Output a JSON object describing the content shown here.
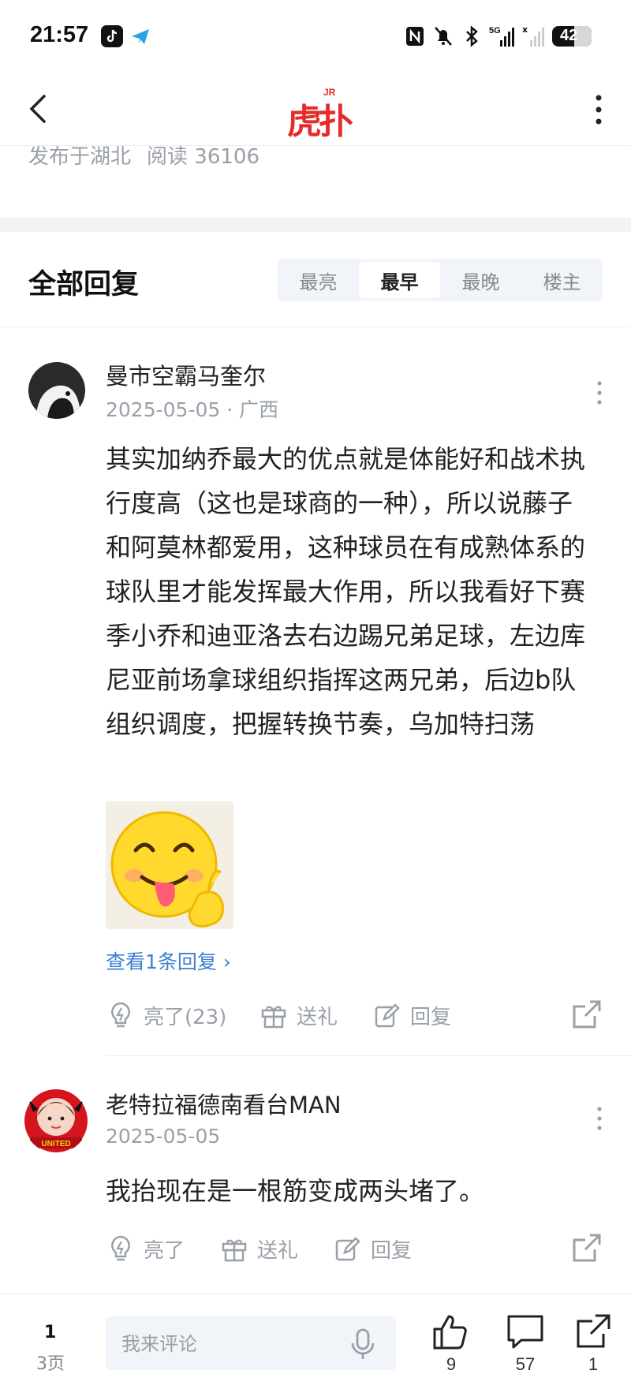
{
  "status_bar": {
    "time": "21:57",
    "battery": "42"
  },
  "nav": {
    "logo_text": "虎扑",
    "logo_badge": "JR"
  },
  "post_meta": {
    "location": "发布于湖北",
    "reads": "阅读 36106"
  },
  "replies": {
    "title": "全部回复",
    "sort_tabs": [
      "最亮",
      "最早",
      "最晚",
      "楼主"
    ],
    "active_sort": "最早"
  },
  "comments": [
    {
      "username": "曼市空霸马奎尔",
      "meta": "2025-05-05 · 广西",
      "body": "其实加纳乔最大的优点就是体能好和战术执行度高（这也是球商的一种），所以说藤子和阿莫林都爱用，这种球员在有成熟体系的球队里才能发挥最大作用，所以我看好下赛季小乔和迪亚洛去右边踢兄弟足球，左边库尼亚前场拿球组织指挥这两兄弟，后边b队组织调度，把握转换节奏，乌加特扫荡",
      "view_replies": "查看1条回复",
      "like_label": "亮了(23)",
      "gift_label": "送礼",
      "reply_label": "回复"
    },
    {
      "username": "老特拉福德南看台MAN",
      "meta": "2025-05-05",
      "body": "我抬现在是一根筋变成两头堵了。",
      "avatar_text": "UNITED",
      "like_label": "亮了",
      "gift_label": "送礼",
      "reply_label": "回复"
    }
  ],
  "bottom_bar": {
    "page_current": "1",
    "page_total": "3页",
    "input_placeholder": "我来评论",
    "like_count": "9",
    "comment_count": "57",
    "share_count": "1"
  },
  "colors": {
    "brand_red": "#e52b2b",
    "link_blue": "#3f7fd0",
    "muted": "#9aa0a8"
  }
}
